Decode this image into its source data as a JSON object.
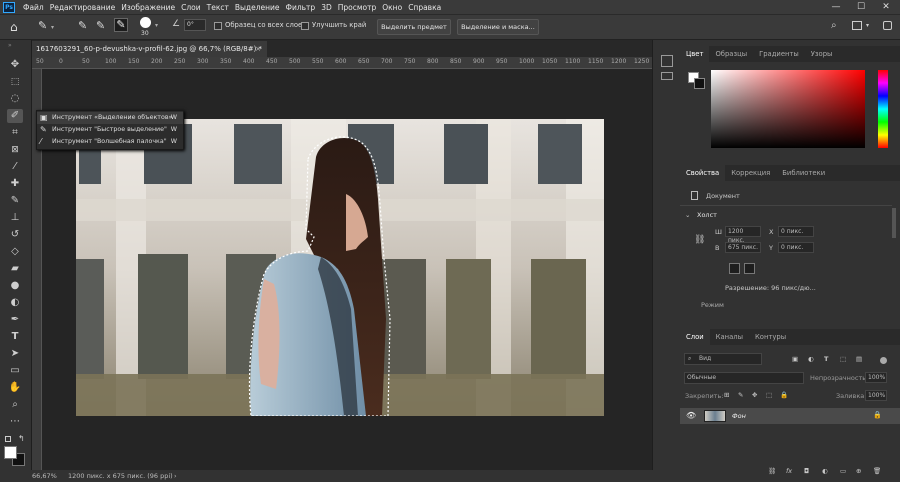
{
  "menu": [
    "Файл",
    "Редактирование",
    "Изображение",
    "Слои",
    "Текст",
    "Выделение",
    "Фильтр",
    "3D",
    "Просмотр",
    "Окно",
    "Справка"
  ],
  "window_controls": {
    "minimize": "—",
    "maximize": "☐",
    "close": "✕"
  },
  "options_bar": {
    "brush_size": "30",
    "angle_symbol": "∠",
    "angle_value": "0°",
    "sample_all_layers": "Образец со всех слоев",
    "enhance_edge": "Улучшить край",
    "select_subject": "Выделить предмет",
    "select_and_mask": "Выделение и маска..."
  },
  "document_tab": {
    "title": "1617603291_60-p-devushka-v-profil-62.jpg @ 66,7% (RGB/8#) *",
    "close": "×"
  },
  "ruler_numbers": [
    "50",
    "0",
    "50",
    "100",
    "150",
    "200",
    "250",
    "300",
    "350",
    "400",
    "450",
    "500",
    "550",
    "600",
    "650",
    "700",
    "750",
    "800",
    "850",
    "900",
    "950",
    "1000",
    "1050",
    "1100",
    "1150",
    "1200",
    "1250"
  ],
  "tool_flyout": [
    {
      "label": "Инструмент «Выделение объектов»",
      "key": "W"
    },
    {
      "label": "Инструмент \"Быстрое выделение\"",
      "key": "W"
    },
    {
      "label": "Инструмент \"Волшебная палочка\"",
      "key": "W"
    }
  ],
  "status": {
    "zoom": "66,67%",
    "info": "1200 пикс. x 675 пикс. (96 ppi)",
    "arrow": "›"
  },
  "color_panel": {
    "tabs": [
      "Цвет",
      "Образцы",
      "Градиенты",
      "Узоры"
    ]
  },
  "properties_panel": {
    "tabs": [
      "Свойства",
      "Коррекция",
      "Библиотеки"
    ],
    "doc_label": "Документ",
    "canvas_section": "Холст",
    "width_label": "Ш",
    "width_value": "1200 пикс.",
    "x_label": "X",
    "x_value": "0 пикс.",
    "height_label": "В",
    "height_value": "675 пикс.",
    "y_label": "Y",
    "y_value": "0 пикс.",
    "resolution": "Разрешение: 96 пикс/дю...",
    "mode": "Режим"
  },
  "layers_panel": {
    "tabs": [
      "Слои",
      "Каналы",
      "Контуры"
    ],
    "filter_kind": "Вид",
    "blend_mode": "Обычные",
    "opacity_label": "Непрозрачность:",
    "opacity_value": "100%",
    "lock_label": "Закрепить:",
    "fill_label": "Заливка:",
    "fill_value": "100%",
    "layer_name": "Фон"
  },
  "colors": {
    "accent": "#31a8ff",
    "panel_bg": "#323232",
    "canvas_bg": "#252525"
  }
}
